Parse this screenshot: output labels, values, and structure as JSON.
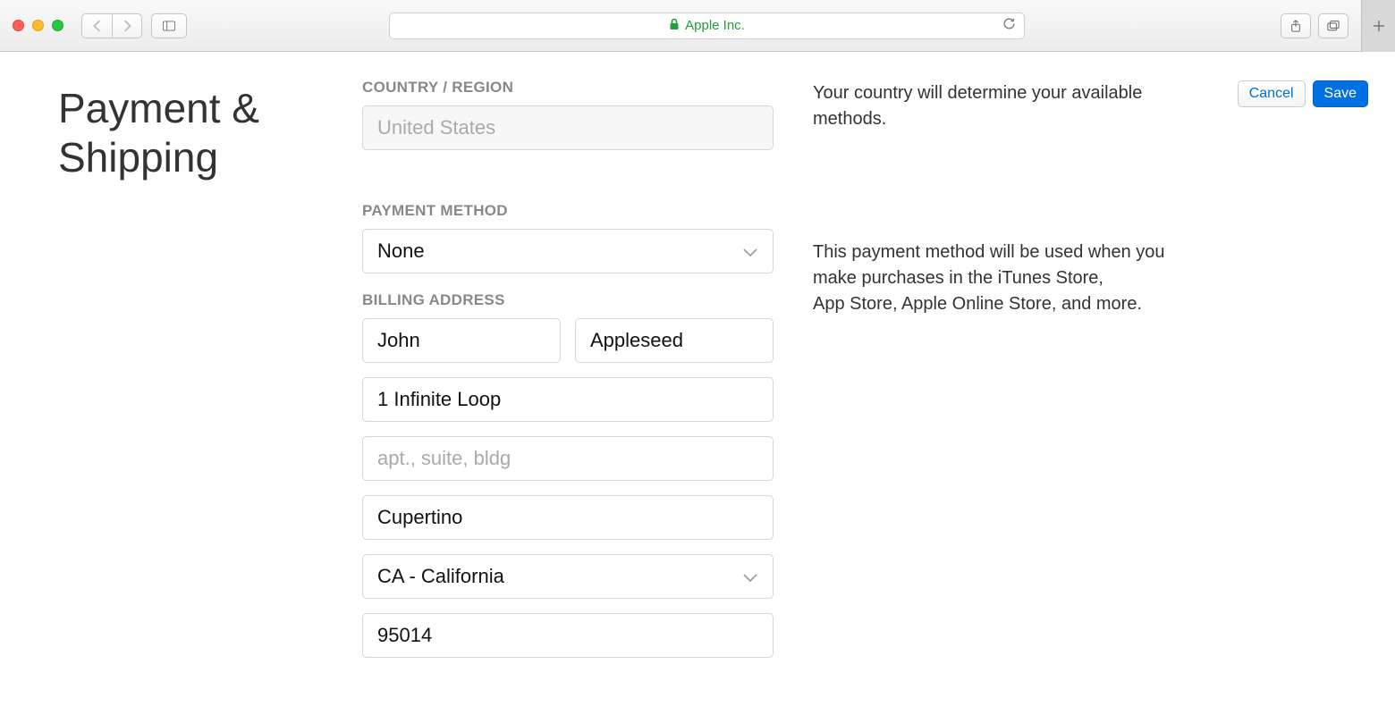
{
  "browser": {
    "site_label": "Apple Inc."
  },
  "header": {
    "title": "Payment & Shipping",
    "cancel_label": "Cancel",
    "save_label": "Save"
  },
  "sections": {
    "country": {
      "label": "COUNTRY / REGION",
      "value": "United States",
      "help": "Your country will determine your available methods."
    },
    "payment": {
      "label": "PAYMENT METHOD",
      "value": "None",
      "help": "This payment method will be used when you make purchases in the iTunes Store, App Store, Apple Online Store, and more."
    },
    "billing": {
      "label": "BILLING ADDRESS",
      "first_name": "John",
      "last_name": "Appleseed",
      "street1": "1 Infinite Loop",
      "street2_placeholder": "apt., suite, bldg",
      "city": "Cupertino",
      "state": "CA - California",
      "zip": "95014"
    }
  }
}
